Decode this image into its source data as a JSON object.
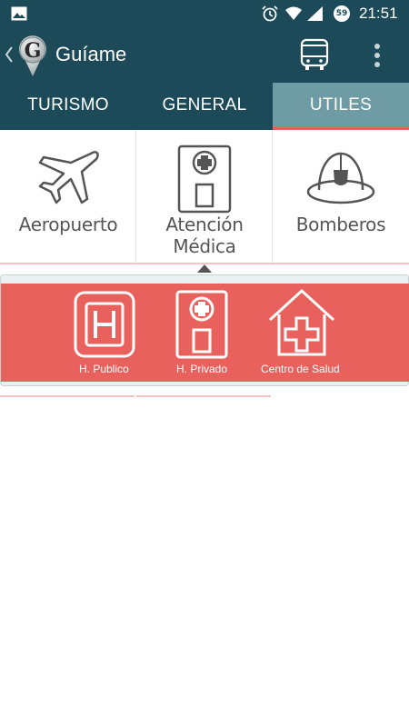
{
  "status_bar": {
    "time": "21:51",
    "battery_level": "59",
    "icons": [
      "image-icon",
      "alarm-icon",
      "wifi-icon",
      "signal-icon",
      "battery-icon"
    ]
  },
  "app_bar": {
    "title": "Guíame",
    "logo_letter": "G",
    "icons": [
      "back-icon",
      "logo-icon",
      "bus-icon",
      "overflow-menu-icon"
    ]
  },
  "tabs": [
    {
      "label": "TURISMO",
      "active": false
    },
    {
      "label": "GENERAL",
      "active": false
    },
    {
      "label": "UTILES",
      "active": true
    }
  ],
  "grid": {
    "items": [
      {
        "label": "Aeropuerto",
        "icon": "airplane-icon"
      },
      {
        "label": "Atención Médica",
        "icon": "hospital-icon"
      },
      {
        "label": "Bomberos",
        "icon": "firefighter-helmet-icon"
      }
    ]
  },
  "submenu": {
    "items": [
      {
        "label": "H. Publico",
        "icon": "h-letter-icon"
      },
      {
        "label": "H. Privado",
        "icon": "private-hospital-icon"
      },
      {
        "label": "Centro de Salud",
        "icon": "health-center-icon"
      }
    ]
  },
  "colors": {
    "primary": "#1c4a58",
    "active_tab": "#6f9ca4",
    "accent": "#e9605c",
    "icon_gray": "#555555"
  }
}
